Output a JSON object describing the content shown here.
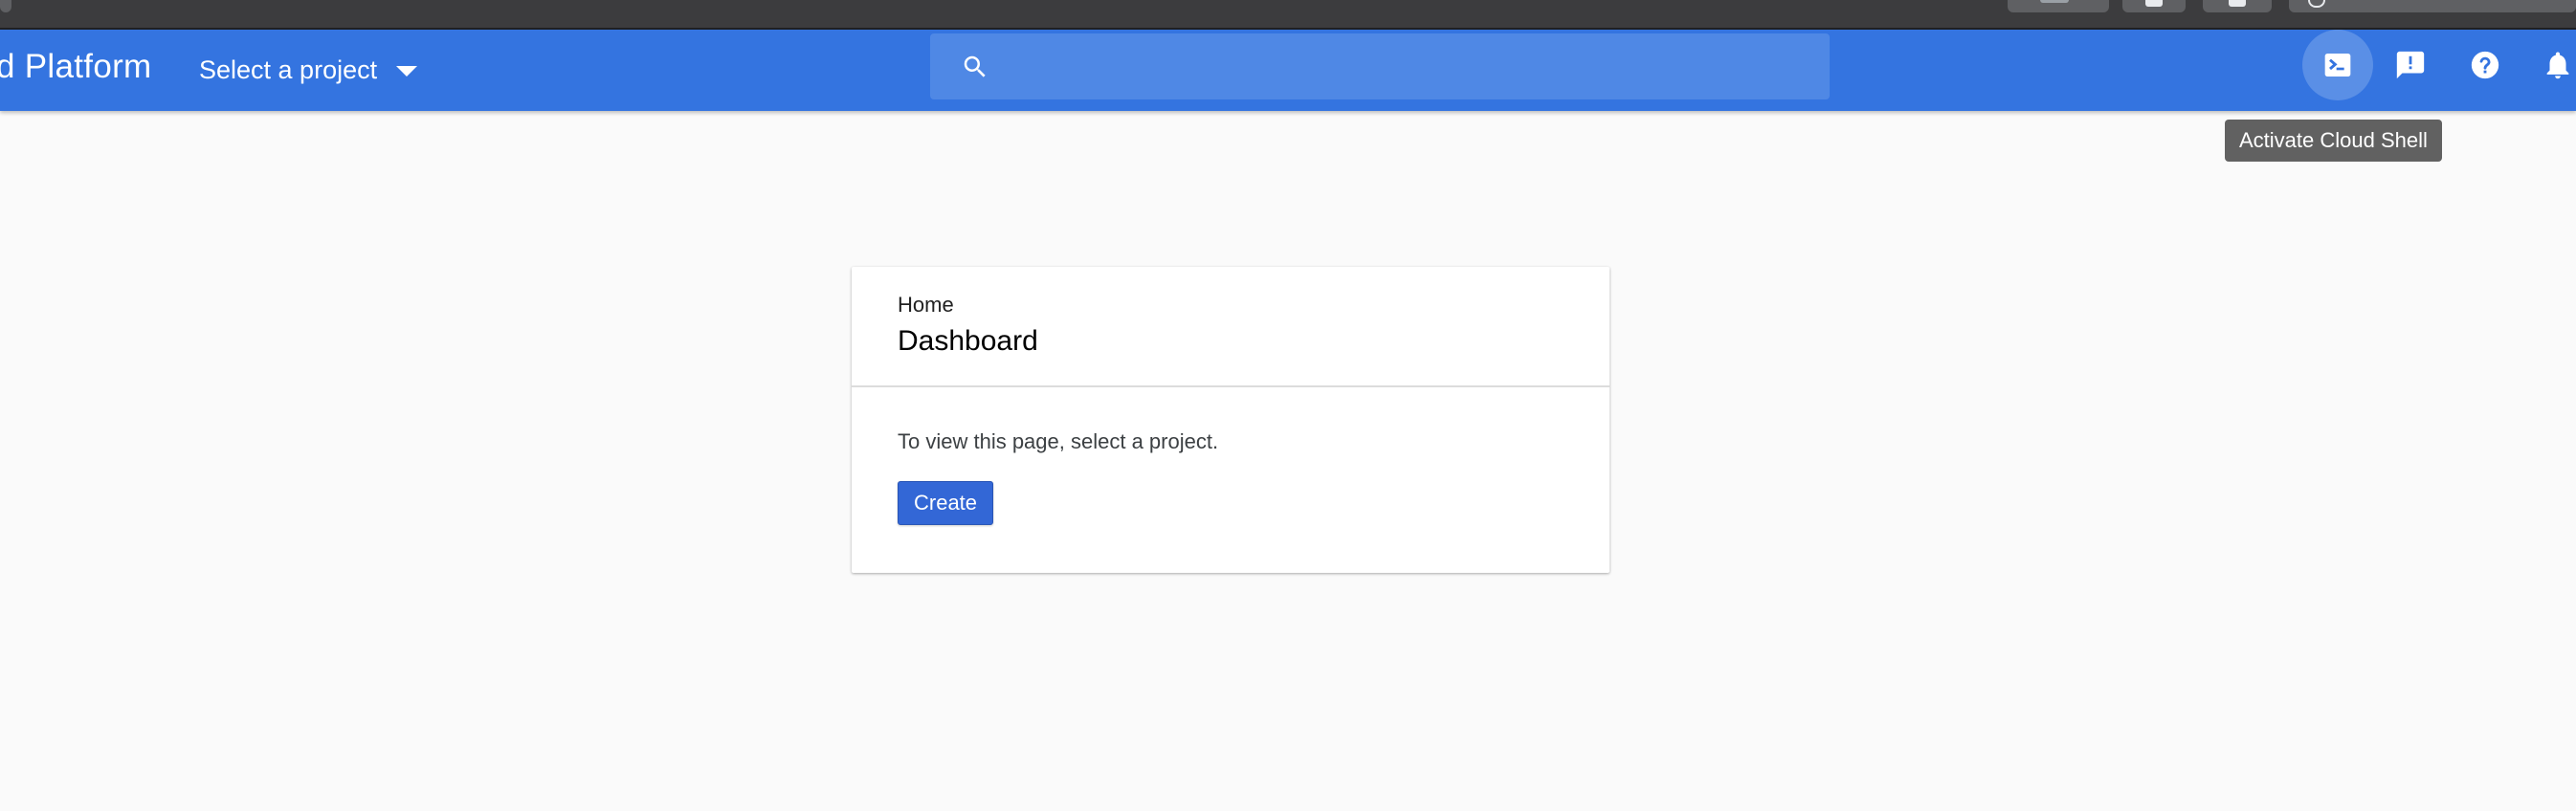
{
  "header": {
    "brand": "d Platform",
    "project_selector_label": "Select a project",
    "search_placeholder": "",
    "accent_color": "#3474e0"
  },
  "actions": {
    "cloud_shell_icon": "terminal-icon",
    "feedback_icon": "feedback-icon",
    "help_icon": "help-icon",
    "notifications_icon": "bell-icon"
  },
  "tooltip": {
    "text": "Activate Cloud Shell"
  },
  "card": {
    "breadcrumb": "Home",
    "title": "Dashboard",
    "message": "To view this page, select a project.",
    "create_label": "Create",
    "button_color": "#3367d6"
  }
}
